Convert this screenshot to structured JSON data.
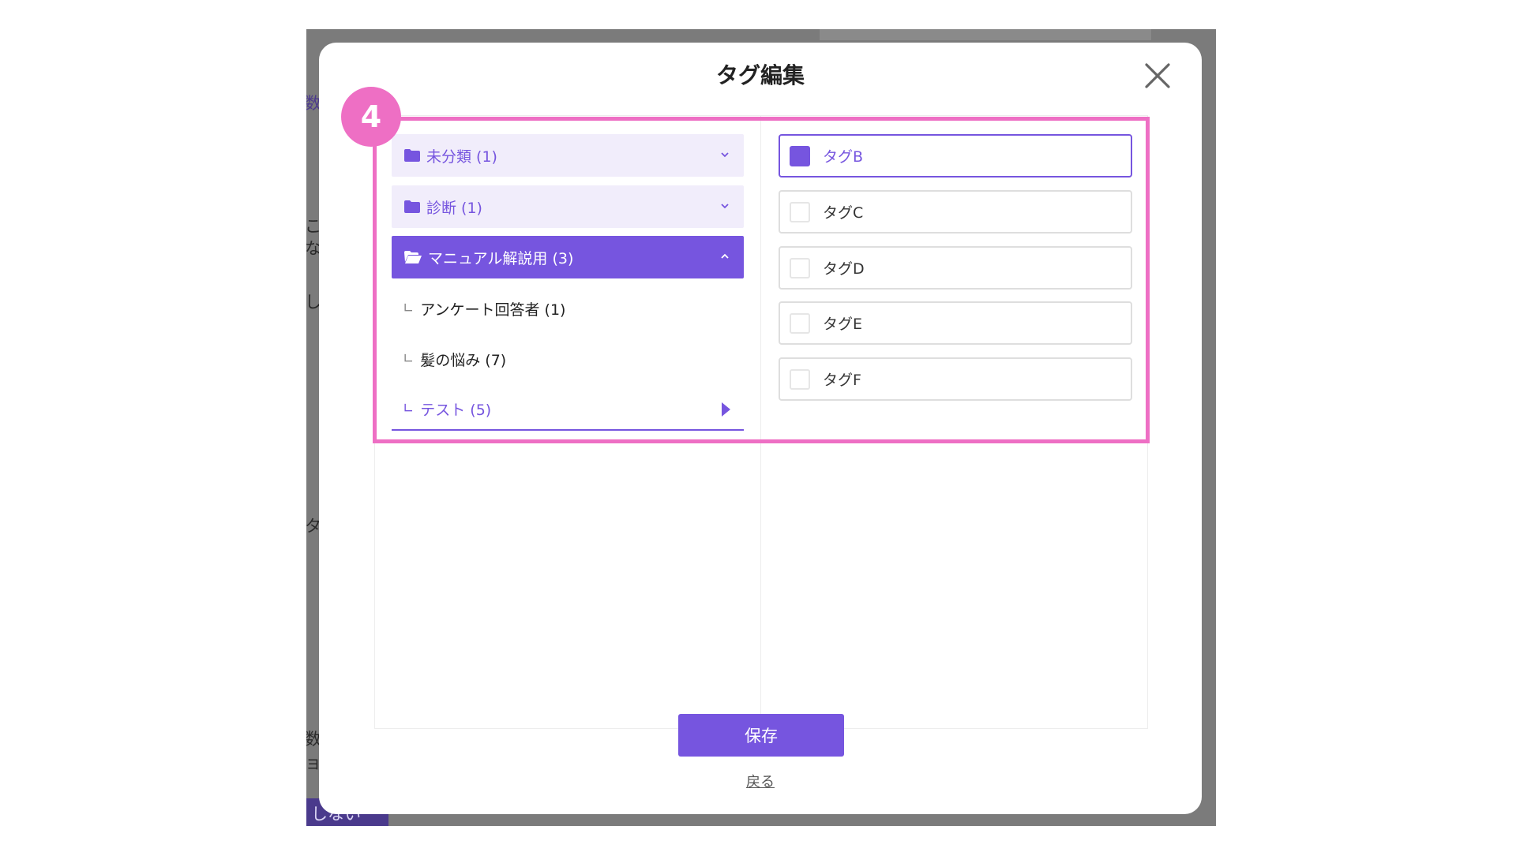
{
  "background": {
    "fragments": [
      "数",
      "こ",
      "な",
      "し",
      "タ",
      "数",
      "ョ"
    ],
    "button_fragment": "しない"
  },
  "modal": {
    "title": "タグ編集",
    "step_number": "4",
    "accent_color": "#7655df",
    "highlight_color": "#ee6fc4"
  },
  "folders": [
    {
      "label": "未分類 (1)",
      "state": "collapsed",
      "icon": "folder-icon"
    },
    {
      "label": "診断 (1)",
      "state": "collapsed",
      "icon": "folder-icon"
    },
    {
      "label": "マニュアル解説用 (3)",
      "state": "expanded",
      "icon": "folder-open-icon"
    }
  ],
  "subfolders": [
    {
      "branch": "∟",
      "label": "アンケート回答者 (1)"
    },
    {
      "branch": "∟",
      "label": "髪の悩み (7)"
    },
    {
      "branch": "∟",
      "label": "テスト (5)",
      "active": true
    }
  ],
  "tags": [
    {
      "label": "タグB",
      "checked": true
    },
    {
      "label": "タグC",
      "checked": false
    },
    {
      "label": "タグD",
      "checked": false
    },
    {
      "label": "タグE",
      "checked": false
    },
    {
      "label": "タグF",
      "checked": false
    }
  ],
  "actions": {
    "save_label": "保存",
    "back_label": "戻る"
  }
}
